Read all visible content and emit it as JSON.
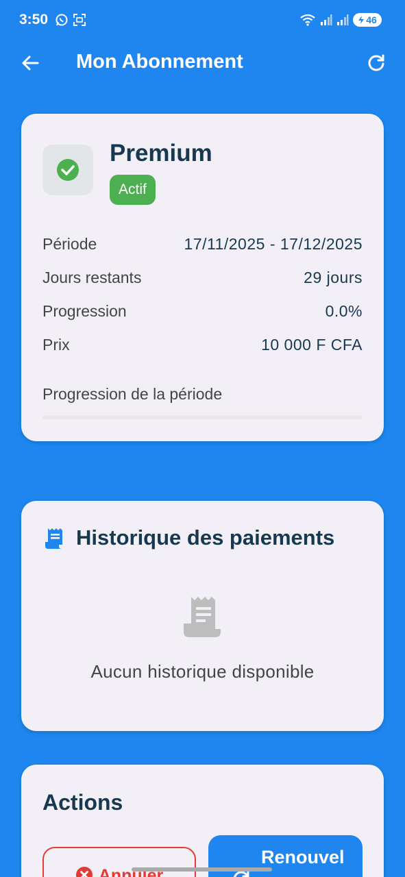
{
  "status_bar": {
    "time": "3:50",
    "battery": "46"
  },
  "app_bar": {
    "title": "Mon Abonnement"
  },
  "subscription": {
    "plan_name": "Premium",
    "status": "Actif",
    "rows": [
      {
        "label": "Période",
        "value": "17/11/2025 - 17/12/2025"
      },
      {
        "label": "Jours restants",
        "value": "29 jours"
      },
      {
        "label": "Progression",
        "value": "0.0%"
      },
      {
        "label": "Prix",
        "value": "10 000 F CFA"
      }
    ],
    "progress_label": "Progression de la période",
    "progress_fraction": 0.0
  },
  "payment_history": {
    "title": "Historique des paiements",
    "empty_text": "Aucun historique disponible"
  },
  "actions": {
    "title": "Actions",
    "cancel_label": "Annuler",
    "renew_label": "Renouvel"
  },
  "colors": {
    "background": "#1E86EE",
    "card": "#F3EFF7",
    "active_green": "#4CAF50",
    "cancel_red": "#E53935",
    "title_text": "#17394F"
  },
  "icons": {
    "back": "arrow-left-icon",
    "refresh": "refresh-icon",
    "plan_status": "check-circle-icon",
    "history": "receipt-icon",
    "empty": "receipt-icon",
    "cancel": "cancel-circle-icon",
    "renew": "refresh-icon"
  }
}
